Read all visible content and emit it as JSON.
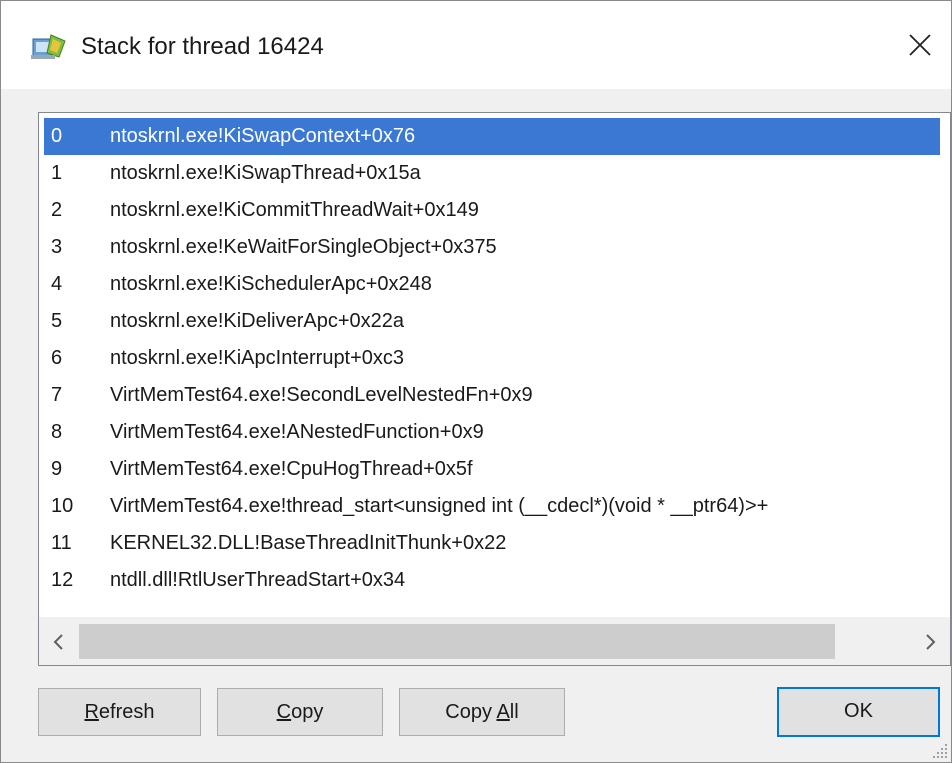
{
  "window": {
    "title": "Stack for thread 16424"
  },
  "stack": {
    "rows": [
      {
        "index": "0",
        "frame": "ntoskrnl.exe!KiSwapContext+0x76"
      },
      {
        "index": "1",
        "frame": "ntoskrnl.exe!KiSwapThread+0x15a"
      },
      {
        "index": "2",
        "frame": "ntoskrnl.exe!KiCommitThreadWait+0x149"
      },
      {
        "index": "3",
        "frame": "ntoskrnl.exe!KeWaitForSingleObject+0x375"
      },
      {
        "index": "4",
        "frame": "ntoskrnl.exe!KiSchedulerApc+0x248"
      },
      {
        "index": "5",
        "frame": "ntoskrnl.exe!KiDeliverApc+0x22a"
      },
      {
        "index": "6",
        "frame": "ntoskrnl.exe!KiApcInterrupt+0xc3"
      },
      {
        "index": "7",
        "frame": "VirtMemTest64.exe!SecondLevelNestedFn+0x9"
      },
      {
        "index": "8",
        "frame": "VirtMemTest64.exe!ANestedFunction+0x9"
      },
      {
        "index": "9",
        "frame": "VirtMemTest64.exe!CpuHogThread+0x5f"
      },
      {
        "index": "10",
        "frame": "VirtMemTest64.exe!thread_start<unsigned int (__cdecl*)(void * __ptr64)>+"
      },
      {
        "index": "11",
        "frame": "KERNEL32.DLL!BaseThreadInitThunk+0x22"
      },
      {
        "index": "12",
        "frame": "ntdll.dll!RtlUserThreadStart+0x34"
      }
    ],
    "selected_index": "0"
  },
  "buttons": {
    "refresh": {
      "mnemonic": "R",
      "rest": "efresh"
    },
    "copy": {
      "mnemonic": "C",
      "rest": "opy"
    },
    "copy_all": {
      "prefix": "Copy ",
      "mnemonic": "A",
      "rest": "ll"
    },
    "ok": "OK"
  },
  "colors": {
    "selection": "#3b78d4",
    "default_button_border": "#0078d7",
    "button_face": "#e1e1e1"
  },
  "icons": {
    "app": "process-explorer-icon",
    "close": "close-icon",
    "scroll_left": "chevron-left-icon",
    "scroll_right": "chevron-right-icon",
    "grip": "resize-grip-icon"
  }
}
